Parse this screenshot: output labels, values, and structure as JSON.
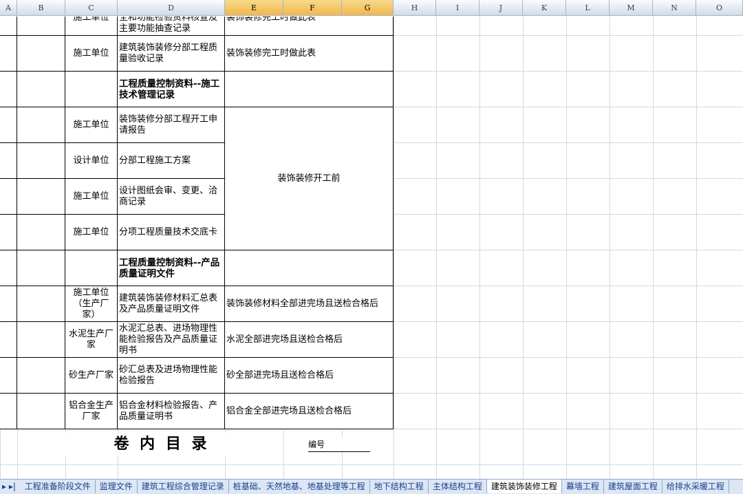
{
  "columns": [
    "A",
    "B",
    "C",
    "D",
    "E",
    "F",
    "G",
    "H",
    "I",
    "J",
    "K",
    "L",
    "M",
    "N",
    "O"
  ],
  "rows": [
    {
      "unit": "施工单位",
      "name": "建筑装饰装修分部工程安全和功能检验资料核查及主要功能抽查记录",
      "timing": "装饰装修完工时做此表"
    },
    {
      "unit": "施工单位",
      "name": "建筑装饰装修分部工程质量验收记录",
      "timing": "装饰装修完工时做此表"
    },
    {
      "unit": "",
      "name": "工程质量控制资料--施工技术管理记录",
      "timing": ""
    },
    {
      "unit": "施工单位",
      "name": "装饰装修分部工程开工申请报告",
      "timing": ""
    },
    {
      "unit": "设计单位",
      "name": "分部工程施工方案",
      "timing": ""
    },
    {
      "unit": "施工单位",
      "name": "设计图纸会审、变更、洽商记录",
      "timing": ""
    },
    {
      "unit": "施工单位",
      "name": "分项工程质量技术交底卡",
      "timing": ""
    },
    {
      "unit": "",
      "name": "工程质量控制资料--产品质量证明文件",
      "timing": ""
    },
    {
      "unit": "施工单位（生产厂家）",
      "name": "建筑装饰装修材料汇总表及产品质量证明文件",
      "timing": "装饰装修材料全部进完场且送检合格后"
    },
    {
      "unit": "水泥生产厂家",
      "name": "水泥汇总表、进场物理性能检验报告及产品质量证明书",
      "timing": "水泥全部进完场且送检合格后"
    },
    {
      "unit": "砂生产厂家",
      "name": "砂汇总表及进场物理性能检验报告",
      "timing": "砂全部进完场且送检合格后"
    },
    {
      "unit": "铝合金生产厂家",
      "name": "铝合金材料检验报告、产品质量证明书",
      "timing": "铝合金全部进完场且送检合格后"
    }
  ],
  "merged_timing": "装饰装修开工前",
  "footer_title": "卷 内 目 录",
  "footer_number_label": "编号",
  "sheet_tabs": [
    "工程准备阶段文件",
    "监理文件",
    "建筑工程综合管理记录",
    "桩基础、天然地基、地基处理等工程",
    "地下结构工程",
    "主体结构工程",
    "建筑装饰装修工程",
    "幕墙工程",
    "建筑屋面工程",
    "给排水采暖工程"
  ],
  "active_tab": "建筑装饰装修工程",
  "nav_glyph": "▸ ▸|"
}
